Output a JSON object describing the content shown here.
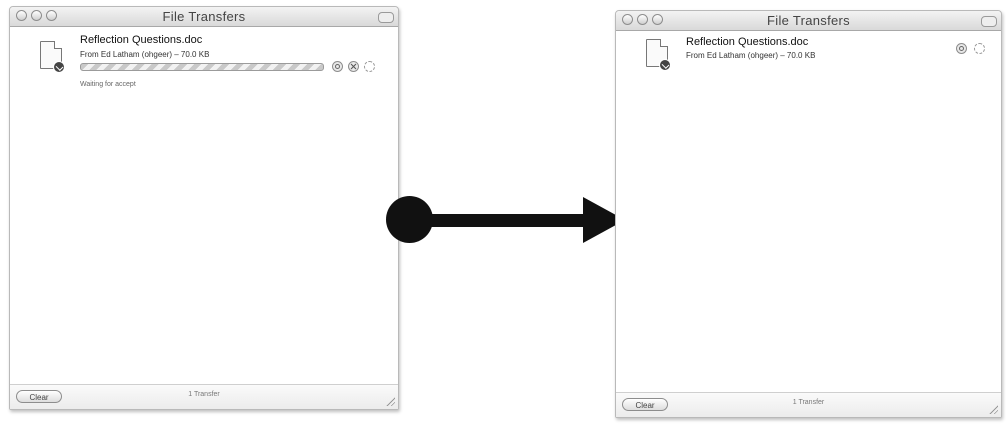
{
  "left_window": {
    "title": "File Transfers",
    "file_name": "Reflection Questions.doc",
    "from_line": "From  Ed Latham (ohgeer) – 70.0 KB",
    "progress": 1.0,
    "status": "Waiting for accept",
    "clear_label": "Clear",
    "transfer_count": "1 Transfer"
  },
  "right_window": {
    "title": "File Transfers",
    "file_name": "Reflection Questions.doc",
    "from_line": "From  Ed Latham (ohgeer) – 70.0 KB",
    "clear_label": "Clear",
    "transfer_count": "1 Transfer"
  }
}
